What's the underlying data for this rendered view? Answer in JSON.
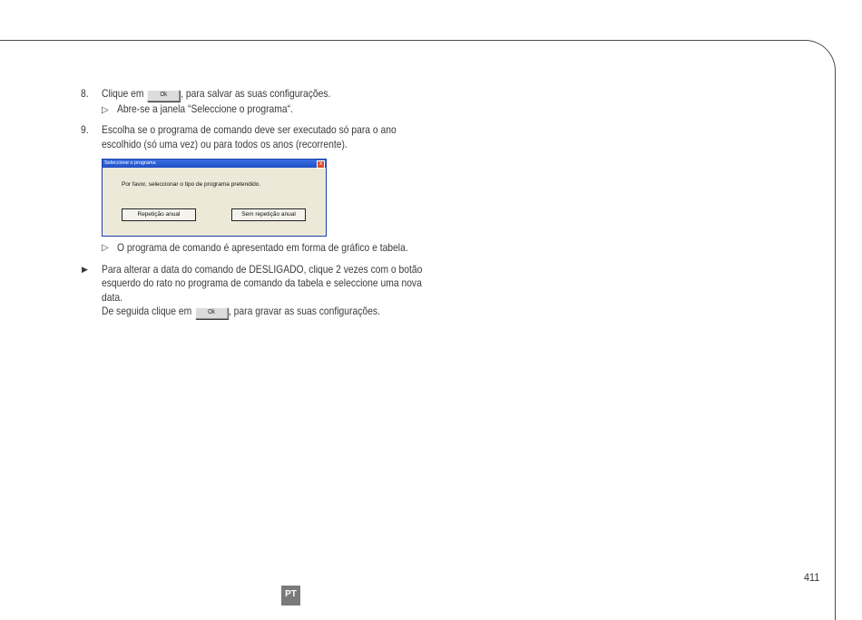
{
  "steps": [
    {
      "number": "8.",
      "line1_before": "Clique em ",
      "button_label": "Ok",
      "line1_after": ", para salvar as suas configurações.",
      "result": "Abre-se a janela “Seleccione o programa“."
    },
    {
      "number": "9.",
      "line1": "Escolha se o programa de comando deve ser executado só para o ano",
      "line2": "escolhido (só uma vez) ou para todos os anos (recorrente).",
      "result": "O programa de comando é apresentado em forma de gráfico e tabela."
    }
  ],
  "dialog": {
    "title": "Seleccione o programa",
    "close_label": "x",
    "message": "Por favor, seleccionar o tipo de programa pretendido.",
    "button_yearly": "Repetição anual",
    "button_no_repeat": "Sem repetição anual"
  },
  "note": {
    "line1": "Para alterar a data do comando de DESLIGADO, clique 2 vezes com o botão",
    "line2": "esquerdo do rato no programa de comando da tabela e seleccione uma nova",
    "line3": "data.",
    "line4_before": "De seguida clique em ",
    "button_label": "Ok",
    "line4_after": ", para gravar as suas configurações."
  },
  "symbols": {
    "result_arrow": "▷",
    "note_arrow": "▶"
  },
  "footer": {
    "page_number": "411",
    "language": "PT"
  }
}
